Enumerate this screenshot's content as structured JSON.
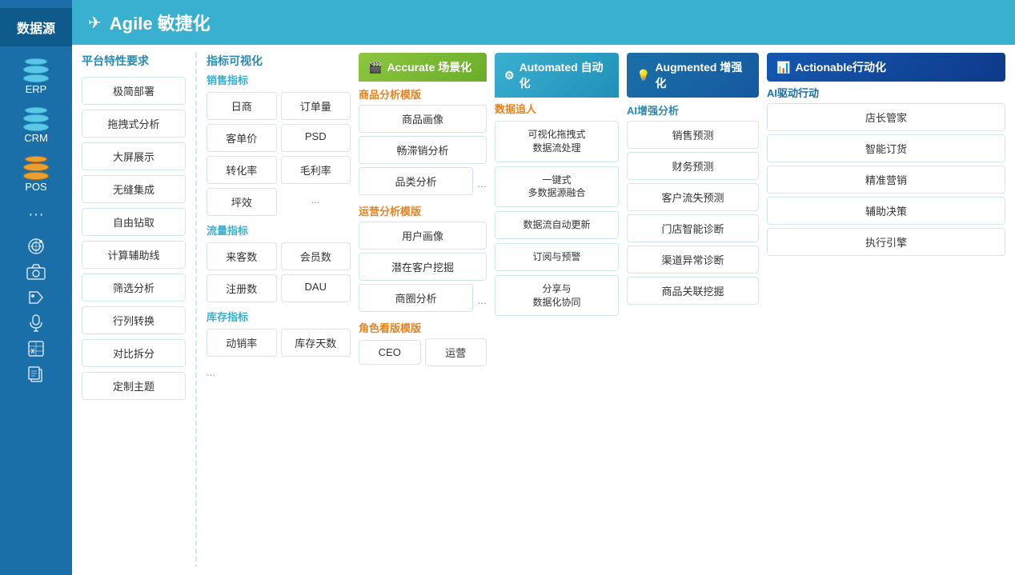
{
  "sidebar": {
    "header": "数据源",
    "items": [
      {
        "label": "ERP",
        "icon": "erp-icon"
      },
      {
        "label": "CRM",
        "icon": "crm-icon"
      },
      {
        "label": "POS",
        "icon": "pos-icon"
      },
      {
        "label": "...",
        "icon": "more-icon"
      }
    ],
    "extra_icons": [
      "weibo-icon",
      "camera-icon",
      "tag-icon",
      "mic-icon",
      "excel-icon",
      "copy-icon"
    ]
  },
  "header": {
    "icon": "✈",
    "title": "Agile 敏捷化"
  },
  "platform": {
    "title": "平台特性要求",
    "features": [
      "极简部署",
      "拖拽式分析",
      "大屏展示",
      "无缝集成",
      "自由钻取",
      "计算辅助线",
      "筛选分析",
      "行列转换",
      "对比拆分",
      "定制主题"
    ]
  },
  "metrics": {
    "title": "指标可视化",
    "sales": {
      "title": "销售指标",
      "items": [
        "日商",
        "订单量",
        "客单价",
        "PSD",
        "转化率",
        "毛利率",
        "坪效"
      ],
      "more": "..."
    },
    "flow": {
      "title": "流量指标",
      "items": [
        "来客数",
        "会员数",
        "注册数",
        "DAU"
      ]
    },
    "inventory": {
      "title": "库存指标",
      "items": [
        "动销率",
        "库存天数"
      ],
      "more": "..."
    }
  },
  "accurate": {
    "header_icon": "🎬",
    "title": "Accurate 场景化",
    "product_analysis": {
      "title": "商品分析模版",
      "items": [
        "商品画像",
        "畅滞销分析",
        "品类分析"
      ],
      "more": "..."
    },
    "ops_analysis": {
      "title": "运营分析模版",
      "items": [
        "用户画像",
        "潜在客户挖掘",
        "商圈分析"
      ],
      "more": "..."
    },
    "role_view": {
      "title": "角色看版模版",
      "items": [
        "CEO",
        "运营"
      ]
    }
  },
  "automated": {
    "header_icon": "⚙",
    "title": "Automated 自动化",
    "data_tracker": {
      "title": "数据追人",
      "items": [
        "可视化拖拽式\n数据流处理",
        "一键式\n多数据源融合",
        "数据流自动更新",
        "订阅与预警",
        "分享与\n数据化协同"
      ]
    }
  },
  "augmented": {
    "header_icon": "💡",
    "title": "Augmented 增强化",
    "ai_analysis": {
      "title": "AI增强分析",
      "items": [
        "销售预测",
        "财务预测",
        "客户流失预测",
        "门店智能诊断",
        "渠道异常诊断",
        "商品关联挖掘"
      ]
    }
  },
  "actionable": {
    "header_icon": "📊",
    "title": "Actionable行动化",
    "ai_action": {
      "title": "AI驱动行动",
      "items": [
        "店长管家",
        "智能订货",
        "精准营销",
        "辅助决策",
        "执行引擎"
      ]
    }
  }
}
